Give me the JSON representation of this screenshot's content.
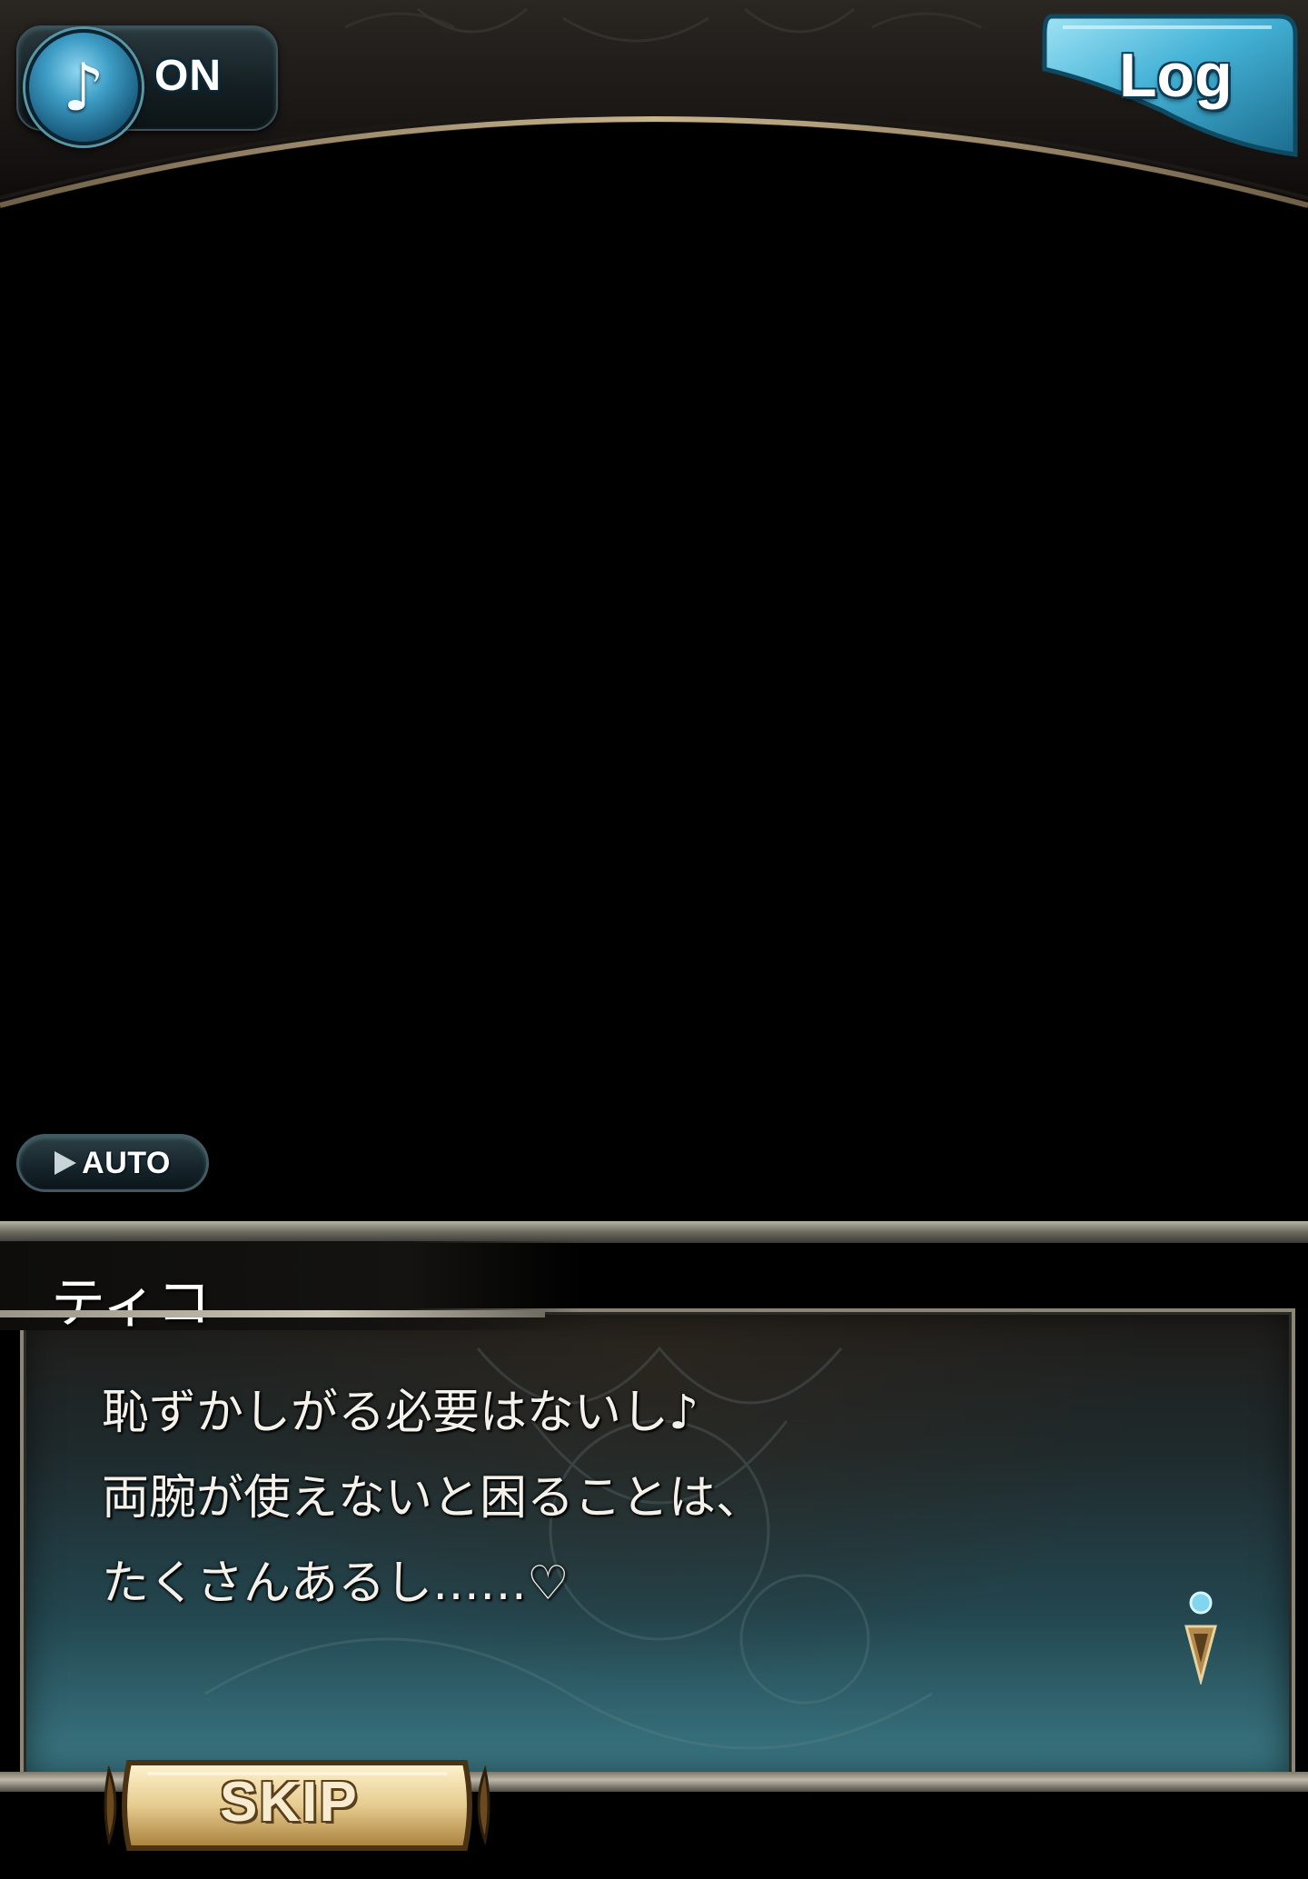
{
  "header": {
    "bgm_toggle": {
      "icon": "music-note-icon",
      "glyph": "♪",
      "state_label": "ON"
    },
    "log_button": {
      "label": "Log"
    }
  },
  "controls": {
    "auto_button": {
      "icon": "play-triangle-icon",
      "label": "AUTO"
    },
    "skip_button": {
      "label": "SKIP"
    }
  },
  "dialogue": {
    "speaker": "ティコ",
    "lines": [
      "恥ずかしがる必要はないし♪",
      "両腕が使えないと困ることは、",
      "たくさんあるし……♡"
    ],
    "next_indicator_icon": "next-page-gem-icon"
  },
  "colors": {
    "accent_blue": "#3d9cc4",
    "frame_bronze": "#8a8577",
    "panel_teal": "#3b7a86",
    "skip_gold": "#e6cc8f"
  }
}
